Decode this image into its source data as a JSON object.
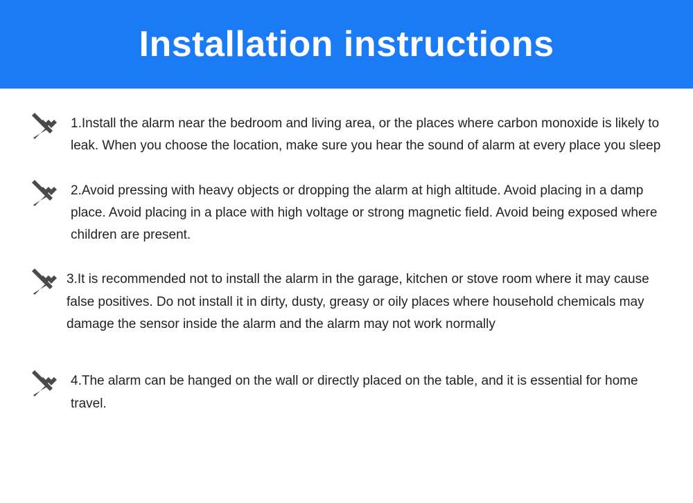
{
  "header": {
    "title": "Installation instructions"
  },
  "items": [
    {
      "text": "1.Install the alarm near the bedroom and living area, or the places where carbon monoxide is likely to leak. When you choose the location, make sure you hear the sound of alarm at every place you sleep"
    },
    {
      "text": "2.Avoid pressing with heavy objects or dropping the alarm at high altitude. Avoid placing in a damp place. Avoid placing in a place with high voltage or strong magnetic field. Avoid being exposed where children are present."
    },
    {
      "text": "3.It is recommended not to install the alarm in the garage, kitchen or stove room where it may cause false positives. Do not install it in dirty, dusty, greasy or oily places where household chemicals may damage the sensor inside the alarm and the alarm may not work normally"
    },
    {
      "text": "4.The alarm can be hanged on the wall or directly placed on the table, and it is essential for home travel."
    }
  ],
  "icon_name": "hammer-tools-icon",
  "colors": {
    "header_bg": "#1a7bf5",
    "text": "#222222",
    "icon": "#4a4a4a"
  }
}
